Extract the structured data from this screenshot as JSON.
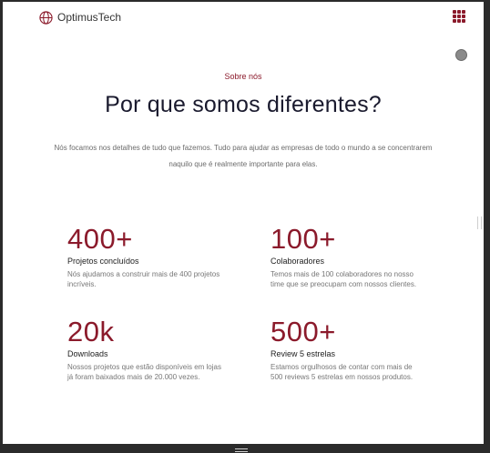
{
  "brand": {
    "name": "OptimusTech",
    "logo_icon": "globe-icon",
    "accent": "#8b1a2b"
  },
  "header": {
    "menu_icon": "grid-menu-icon"
  },
  "hero": {
    "eyebrow": "Sobre nós",
    "title": "Por que somos diferentes?",
    "intro": "Nós focamos nos detalhes de tudo que fazemos. Tudo para ajudar as empresas de todo o mundo a se concentrarem naquilo que é realmente importante para elas."
  },
  "stats": [
    {
      "value": "400+",
      "label": "Projetos concluídos",
      "description": "Nós ajudamos a construir mais de 400 projetos incríveis."
    },
    {
      "value": "100+",
      "label": "Colaboradores",
      "description": "Temos mais de 100 colaboradores no nosso time que se preocupam com nossos clientes."
    },
    {
      "value": "20k",
      "label": "Downloads",
      "description": "Nossos projetos que estão disponíveis em lojas já foram baixados mais de 20.000 vezes."
    },
    {
      "value": "500+",
      "label": "Review 5 estrelas",
      "description": "Estamos orgulhosos de contar com mais de 500 reviews 5 estrelas em nossos produtos."
    }
  ]
}
